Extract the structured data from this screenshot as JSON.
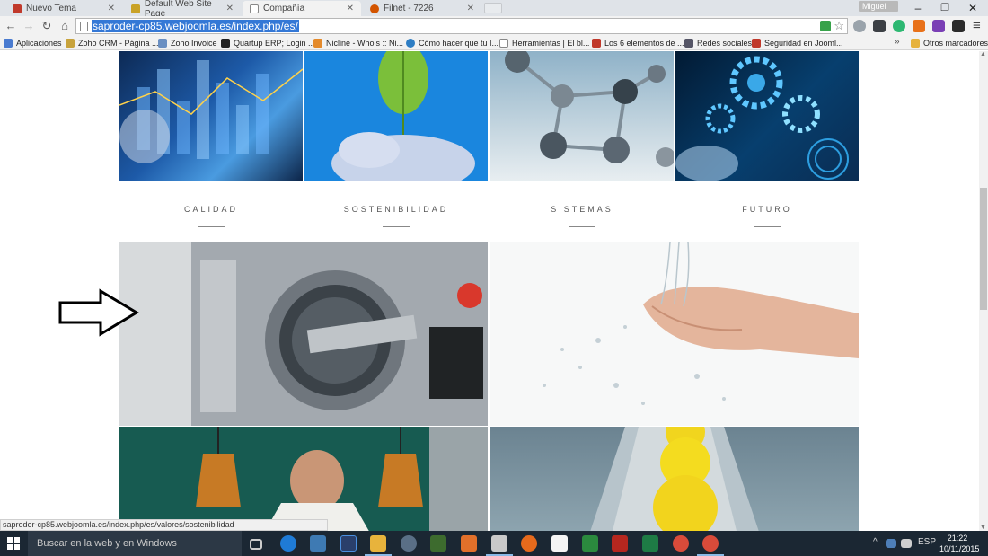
{
  "browser": {
    "tabs": [
      {
        "title": "Nuevo Tema",
        "active": false,
        "icon": "w-favicon-icon"
      },
      {
        "title": "Default Web Site Page",
        "active": false,
        "icon": "iis-favicon-icon"
      },
      {
        "title": "Compañía",
        "active": true,
        "icon": "page-icon"
      },
      {
        "title": "Filnet - 7226",
        "active": false,
        "icon": "filnet-favicon-icon"
      }
    ],
    "user_label": "Miguel",
    "url": "saproder-cp85.webjoomla.es/index.php/es/",
    "bookmarks": [
      "Aplicaciones",
      "Zoho CRM - Página ...",
      "Zoho Invoice",
      "Quartup ERP; Login ...",
      "Nicline - Whois :: Ni...",
      "Cómo hacer que tu I...",
      "Herramientas | El bl...",
      "Los 6 elementos de ...",
      "Redes sociales",
      "Seguridad en Jooml..."
    ],
    "bookmarks_more": "»",
    "other_bookmarks": "Otros marcadores"
  },
  "page": {
    "categories": [
      "CALIDAD",
      "SOSTENIBILIDAD",
      "SISTEMAS",
      "FUTURO"
    ]
  },
  "status_bar": "saproder-cp85.webjoomla.es/index.php/es/valores/sostenibilidad",
  "taskbar": {
    "search_placeholder": "Buscar en la web y en Windows",
    "language": "ESP",
    "time": "21:22",
    "date": "10/11/2015"
  }
}
